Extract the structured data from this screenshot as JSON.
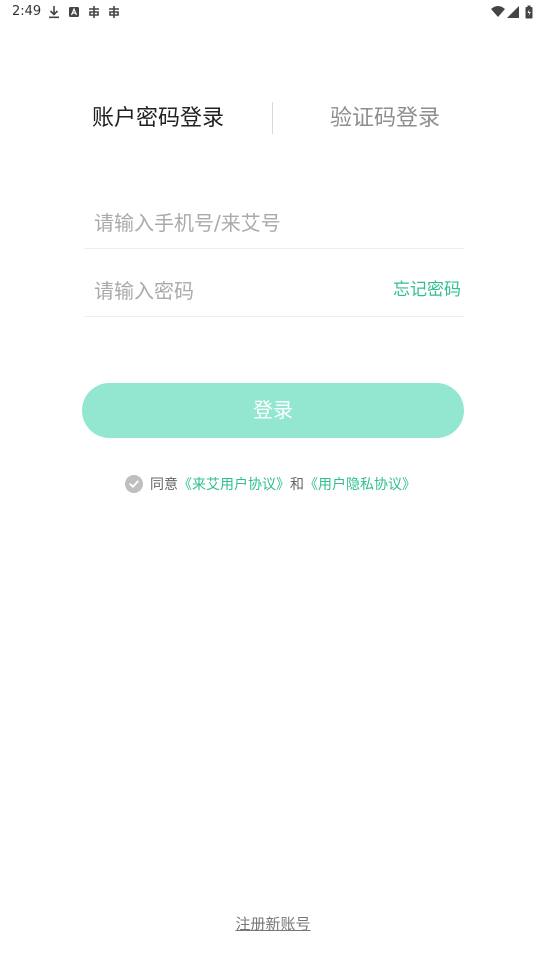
{
  "status_bar": {
    "time": "2:49",
    "icons": [
      "download-icon",
      "a-icon",
      "app-icon",
      "app-icon",
      "wifi-icon",
      "signal-icon",
      "battery-icon"
    ]
  },
  "tabs": {
    "password_login": "账户密码登录",
    "code_login": "验证码登录"
  },
  "form": {
    "phone_placeholder": "请输入手机号/来艾号",
    "password_placeholder": "请输入密码",
    "forgot_password": "忘记密码",
    "login_button": "登录"
  },
  "agreement": {
    "prefix": "同意",
    "user_agreement": "《来艾用户协议》",
    "and": "和",
    "privacy_agreement": "《用户隐私协议》"
  },
  "register": {
    "label": "注册新账号"
  },
  "colors": {
    "accent": "#2fbf92",
    "button_disabled": "#93e6d0"
  }
}
